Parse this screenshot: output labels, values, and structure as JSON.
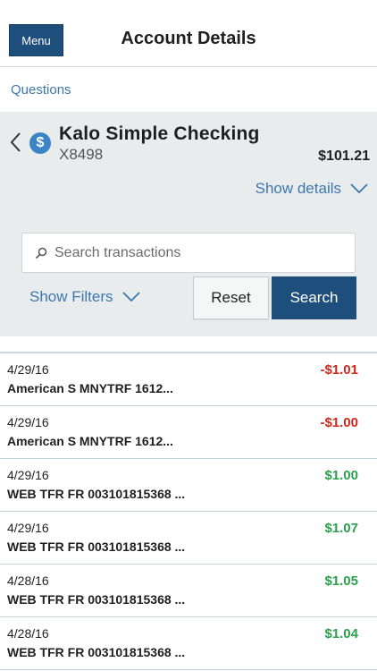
{
  "header": {
    "menu_label": "Menu",
    "title": "Account Details"
  },
  "questions_link": "Questions",
  "account": {
    "name": "Kalo Simple Checking",
    "number": "X8498",
    "balance": "$101.21",
    "show_details": "Show details",
    "icon": "dollar-icon"
  },
  "search": {
    "placeholder": "Search transactions",
    "value": "",
    "show_filters": "Show Filters",
    "reset_label": "Reset",
    "search_label": "Search"
  },
  "colors": {
    "accent": "#1d4e7c",
    "link": "#3d77ad",
    "negative": "#d0281d",
    "positive": "#2aa14b",
    "panel": "#e9eced"
  },
  "transactions": [
    {
      "date": "4/29/16",
      "description": "American S MNYTRF 1612...",
      "amount": "-$1.01",
      "type": "negative"
    },
    {
      "date": "4/29/16",
      "description": "American S MNYTRF 1612...",
      "amount": "-$1.00",
      "type": "negative"
    },
    {
      "date": "4/29/16",
      "description": "WEB TFR FR 003101815368 ...",
      "amount": "$1.00",
      "type": "positive"
    },
    {
      "date": "4/29/16",
      "description": "WEB TFR FR 003101815368 ...",
      "amount": "$1.07",
      "type": "positive"
    },
    {
      "date": "4/28/16",
      "description": "WEB TFR FR 003101815368 ...",
      "amount": "$1.05",
      "type": "positive"
    },
    {
      "date": "4/28/16",
      "description": "WEB TFR FR 003101815368 ...",
      "amount": "$1.04",
      "type": "positive"
    }
  ]
}
